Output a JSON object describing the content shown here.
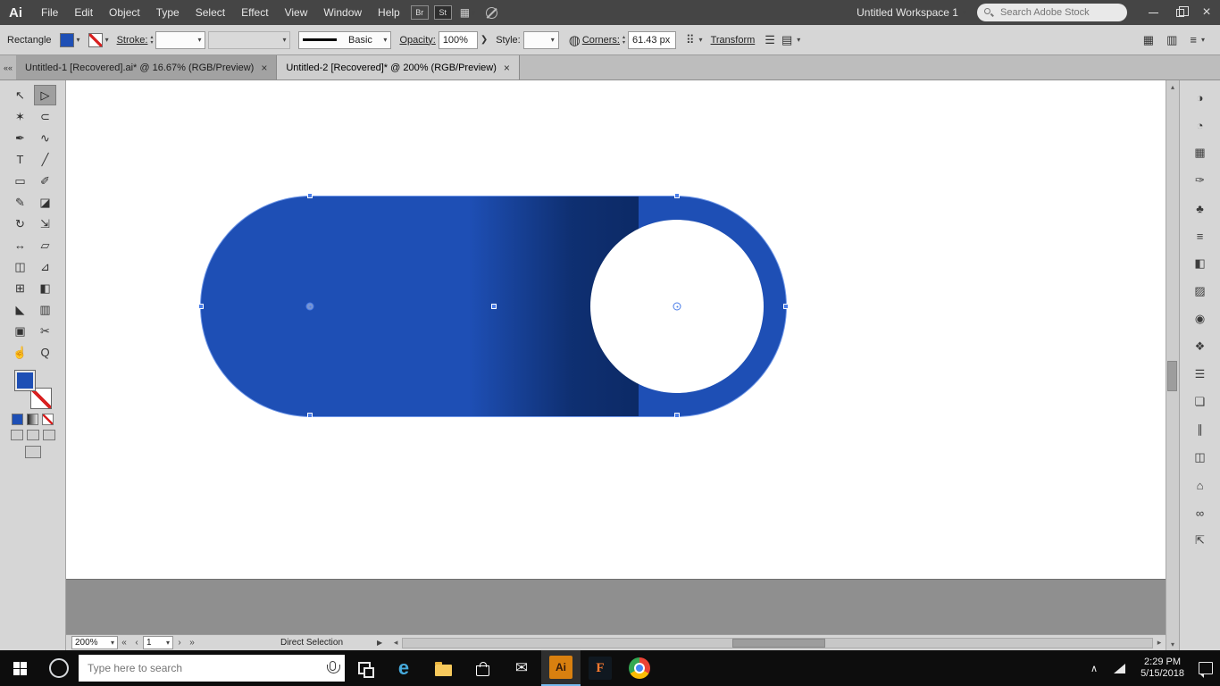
{
  "ui": {
    "chevron": "▾",
    "up": "▴",
    "down": "▾",
    "close": "×",
    "collapse": "««"
  },
  "menubar": {
    "app_logo": "Ai",
    "menus": [
      "File",
      "Edit",
      "Object",
      "Type",
      "Select",
      "Effect",
      "View",
      "Window",
      "Help"
    ],
    "bridge_label": "Br",
    "stock_label": "St",
    "arrange_icon": "▦",
    "workspace_label": "Untitled Workspace 1",
    "search_placeholder": "Search Adobe Stock",
    "close_icon": "×"
  },
  "controlbar": {
    "context_label": "Rectangle",
    "stroke_label": "Stroke:",
    "profile_label": "Basic",
    "opacity_label": "Opacity:",
    "opacity_value": "100%",
    "opacity_arrow": "❯",
    "style_label": "Style:",
    "recolor_icon": "◍",
    "corners_label": "Corners:",
    "corners_value": "61.43 px",
    "grid_icon": "⠿",
    "transform_label": "Transform",
    "align_icon_a": "☰",
    "align_icon_b": "▤",
    "arrange_icon": "▦",
    "dock_icon": "▥",
    "menu_icon": "≡"
  },
  "tabbar": {
    "tabs": [
      {
        "title": "Untitled-1 [Recovered].ai* @ 16.67% (RGB/Preview)"
      },
      {
        "title": "Untitled-2 [Recovered]* @ 200% (RGB/Preview)"
      }
    ]
  },
  "toolbar": {
    "tools": [
      {
        "name": "selection",
        "glyph": "↖"
      },
      {
        "name": "direct-selection",
        "glyph": "▷"
      },
      {
        "name": "magic-wand",
        "glyph": "✶"
      },
      {
        "name": "lasso",
        "glyph": "⊂"
      },
      {
        "name": "pen",
        "glyph": "✒"
      },
      {
        "name": "curvature",
        "glyph": "∿"
      },
      {
        "name": "type",
        "glyph": "T"
      },
      {
        "name": "line-segment",
        "glyph": "╱"
      },
      {
        "name": "rectangle",
        "glyph": "▭"
      },
      {
        "name": "paintbrush",
        "glyph": "✐"
      },
      {
        "name": "pencil",
        "glyph": "✎"
      },
      {
        "name": "eraser",
        "glyph": "◪"
      },
      {
        "name": "rotate",
        "glyph": "↻"
      },
      {
        "name": "scale",
        "glyph": "⇲"
      },
      {
        "name": "width",
        "glyph": "↔"
      },
      {
        "name": "free-transform",
        "glyph": "▱"
      },
      {
        "name": "shape-builder",
        "glyph": "◫"
      },
      {
        "name": "perspective-grid",
        "glyph": "⊿"
      },
      {
        "name": "mesh",
        "glyph": "⊞"
      },
      {
        "name": "gradient",
        "glyph": "◧"
      },
      {
        "name": "eyedropper",
        "glyph": "◣"
      },
      {
        "name": "graph",
        "glyph": "▥"
      },
      {
        "name": "artboard",
        "glyph": "▣"
      },
      {
        "name": "slice",
        "glyph": "✂"
      },
      {
        "name": "hand",
        "glyph": "☝"
      },
      {
        "name": "zoom",
        "glyph": "Q"
      }
    ]
  },
  "panels": {
    "icons": [
      {
        "name": "color",
        "glyph": "◑"
      },
      {
        "name": "color-guide",
        "glyph": "◔"
      },
      {
        "name": "swatches",
        "glyph": "▦"
      },
      {
        "name": "brushes",
        "glyph": "✑"
      },
      {
        "name": "symbols",
        "glyph": "♣"
      },
      {
        "name": "stroke",
        "glyph": "≡"
      },
      {
        "name": "gradient",
        "glyph": "◧"
      },
      {
        "name": "transparency",
        "glyph": "▨"
      },
      {
        "name": "appearance",
        "glyph": "◉"
      },
      {
        "name": "graphic-styles",
        "glyph": "❖"
      },
      {
        "name": "layers",
        "glyph": "☰"
      },
      {
        "name": "artboards",
        "glyph": "❏"
      },
      {
        "name": "align",
        "glyph": "∥"
      },
      {
        "name": "pathfinder",
        "glyph": "◫"
      },
      {
        "name": "libraries",
        "glyph": "⌂"
      },
      {
        "name": "links",
        "glyph": "∞"
      },
      {
        "name": "asset-export",
        "glyph": "⇱"
      }
    ]
  },
  "canvas": {
    "shape": "rounded-rectangle toggle",
    "fill_color": "#1e4fb5",
    "shadow_color": "#0c2a66",
    "knob_color": "#ffffff",
    "selection_color": "#4a7de8"
  },
  "statusbar": {
    "zoom": "200%",
    "nav_first": "«",
    "nav_prev": "‹",
    "artboard_number": "1",
    "nav_next": "›",
    "nav_last": "»",
    "tool_name": "Direct Selection",
    "flyout": "▶",
    "scroll_left": "◂",
    "scroll_right": "▸"
  },
  "taskbar": {
    "search_placeholder": "Type here to search",
    "edge_label": "e",
    "mail_icon": "✉",
    "ai_label": "Ai",
    "fuse_label": "F",
    "tray_expand": "∧",
    "time": "2:29 PM",
    "date": "5/15/2018"
  }
}
